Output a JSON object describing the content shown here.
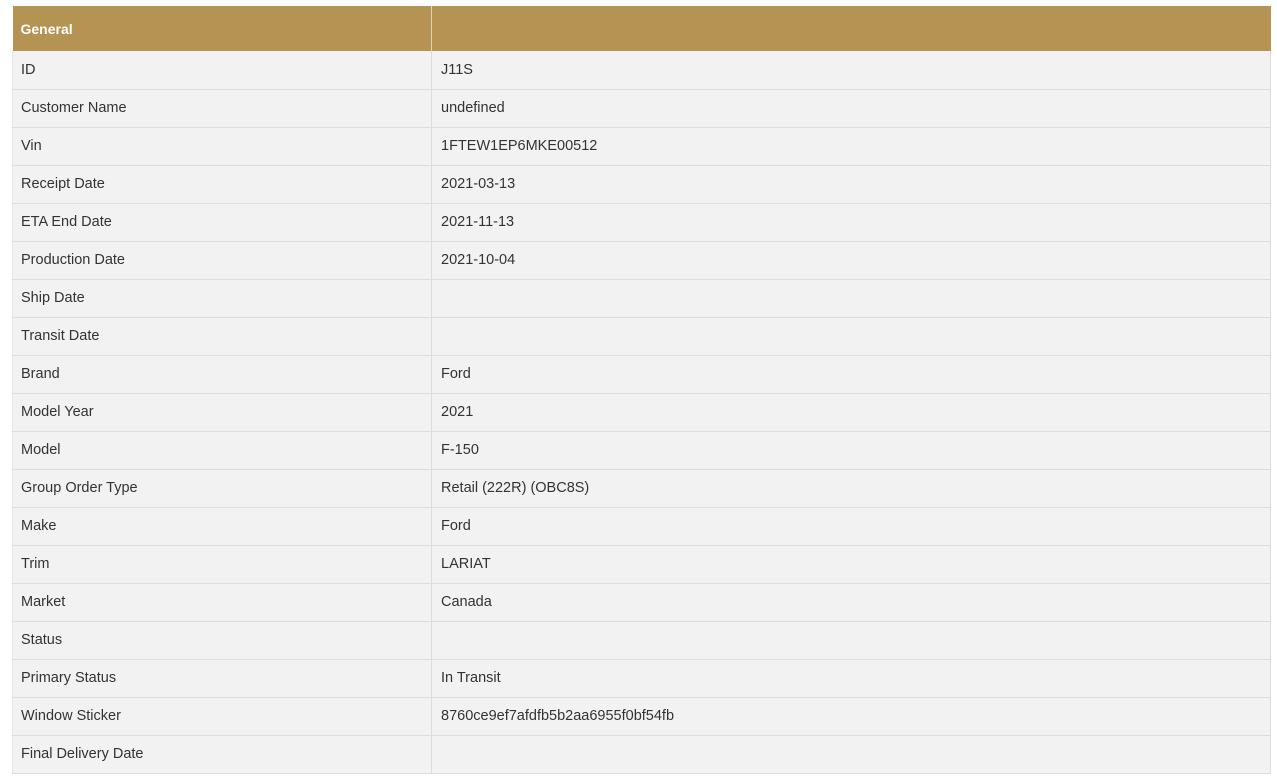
{
  "table": {
    "headers": [
      "General",
      ""
    ],
    "rows": [
      {
        "label": "ID",
        "value": "J11S"
      },
      {
        "label": "Customer Name",
        "value": "undefined"
      },
      {
        "label": "Vin",
        "value": "1FTEW1EP6MKE00512"
      },
      {
        "label": "Receipt Date",
        "value": "2021-03-13"
      },
      {
        "label": "ETA End Date",
        "value": "2021-11-13"
      },
      {
        "label": "Production Date",
        "value": "2021-10-04"
      },
      {
        "label": "Ship Date",
        "value": ""
      },
      {
        "label": "Transit Date",
        "value": ""
      },
      {
        "label": "Brand",
        "value": "Ford"
      },
      {
        "label": "Model Year",
        "value": "2021"
      },
      {
        "label": "Model",
        "value": "F-150"
      },
      {
        "label": "Group Order Type",
        "value": "Retail (222R) (OBC8S)"
      },
      {
        "label": "Make",
        "value": "Ford"
      },
      {
        "label": "Trim",
        "value": "LARIAT"
      },
      {
        "label": "Market",
        "value": "Canada"
      },
      {
        "label": "Status",
        "value": ""
      },
      {
        "label": "Primary Status",
        "value": "In Transit"
      },
      {
        "label": "Window Sticker",
        "value": "8760ce9ef7afdfb5b2aa6955f0bf54fb"
      },
      {
        "label": "Final Delivery Date",
        "value": ""
      }
    ]
  },
  "colors": {
    "header_bg": "#b59453",
    "header_text": "#ffffff",
    "row_bg": "#f2f2f2",
    "text": "#333333",
    "border": "#dcdcdc"
  }
}
